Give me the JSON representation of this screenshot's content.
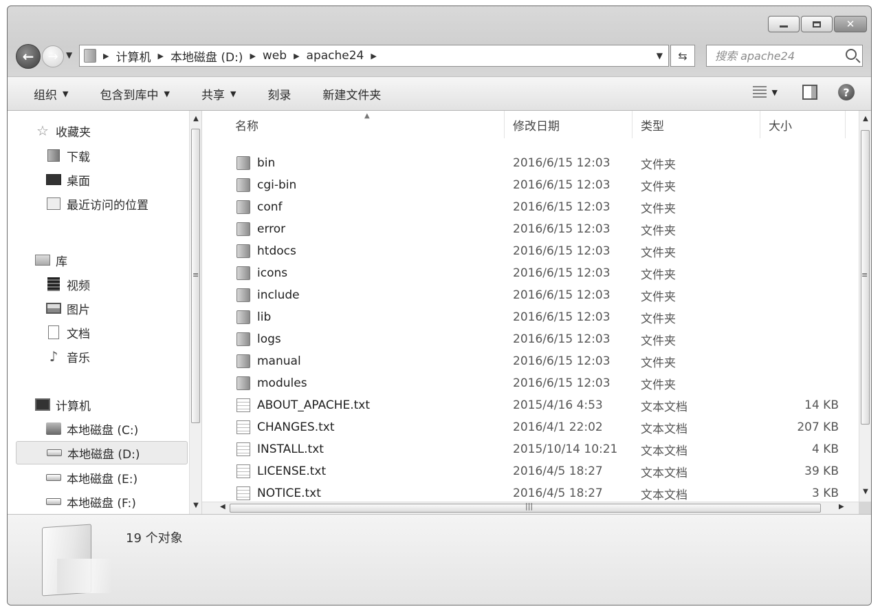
{
  "address": {
    "breadcrumbs": [
      "计算机",
      "本地磁盘 (D:)",
      "web",
      "apache24"
    ]
  },
  "search": {
    "placeholder": "搜索 apache24"
  },
  "toolbar": {
    "organize": "组织",
    "include_in_library": "包含到库中",
    "share": "共享",
    "burn": "刻录",
    "new_folder": "新建文件夹"
  },
  "nav": {
    "favorites": "收藏夹",
    "downloads": "下载",
    "desktop": "桌面",
    "recent": "最近访问的位置",
    "libraries": "库",
    "videos": "视频",
    "pictures": "图片",
    "documents": "文档",
    "music": "音乐",
    "computer": "计算机",
    "drive_c": "本地磁盘 (C:)",
    "drive_d": "本地磁盘 (D:)",
    "drive_e": "本地磁盘 (E:)",
    "drive_f": "本地磁盘 (F:)"
  },
  "columns": {
    "name": "名称",
    "date": "修改日期",
    "type": "类型",
    "size": "大小"
  },
  "files": [
    {
      "name": "bin",
      "date": "2016/6/15 12:03",
      "type": "文件夹",
      "size": "",
      "icon": "folder-icon"
    },
    {
      "name": "cgi-bin",
      "date": "2016/6/15 12:03",
      "type": "文件夹",
      "size": "",
      "icon": "folder-icon"
    },
    {
      "name": "conf",
      "date": "2016/6/15 12:03",
      "type": "文件夹",
      "size": "",
      "icon": "folder-icon"
    },
    {
      "name": "error",
      "date": "2016/6/15 12:03",
      "type": "文件夹",
      "size": "",
      "icon": "folder-icon"
    },
    {
      "name": "htdocs",
      "date": "2016/6/15 12:03",
      "type": "文件夹",
      "size": "",
      "icon": "folder-icon"
    },
    {
      "name": "icons",
      "date": "2016/6/15 12:03",
      "type": "文件夹",
      "size": "",
      "icon": "folder-icon"
    },
    {
      "name": "include",
      "date": "2016/6/15 12:03",
      "type": "文件夹",
      "size": "",
      "icon": "folder-icon"
    },
    {
      "name": "lib",
      "date": "2016/6/15 12:03",
      "type": "文件夹",
      "size": "",
      "icon": "folder-icon"
    },
    {
      "name": "logs",
      "date": "2016/6/15 12:03",
      "type": "文件夹",
      "size": "",
      "icon": "folder-icon"
    },
    {
      "name": "manual",
      "date": "2016/6/15 12:03",
      "type": "文件夹",
      "size": "",
      "icon": "folder-icon"
    },
    {
      "name": "modules",
      "date": "2016/6/15 12:03",
      "type": "文件夹",
      "size": "",
      "icon": "folder-icon"
    },
    {
      "name": "ABOUT_APACHE.txt",
      "date": "2015/4/16 4:53",
      "type": "文本文档",
      "size": "14 KB",
      "icon": "text-file-icon"
    },
    {
      "name": "CHANGES.txt",
      "date": "2016/4/1 22:02",
      "type": "文本文档",
      "size": "207 KB",
      "icon": "text-file-icon"
    },
    {
      "name": "INSTALL.txt",
      "date": "2015/10/14 10:21",
      "type": "文本文档",
      "size": "4 KB",
      "icon": "text-file-icon"
    },
    {
      "name": "LICENSE.txt",
      "date": "2016/4/5 18:27",
      "type": "文本文档",
      "size": "39 KB",
      "icon": "text-file-icon"
    },
    {
      "name": "NOTICE.txt",
      "date": "2016/4/5 18:27",
      "type": "文本文档",
      "size": "3 KB",
      "icon": "text-file-icon"
    }
  ],
  "status": {
    "item_count": "19 个对象"
  }
}
